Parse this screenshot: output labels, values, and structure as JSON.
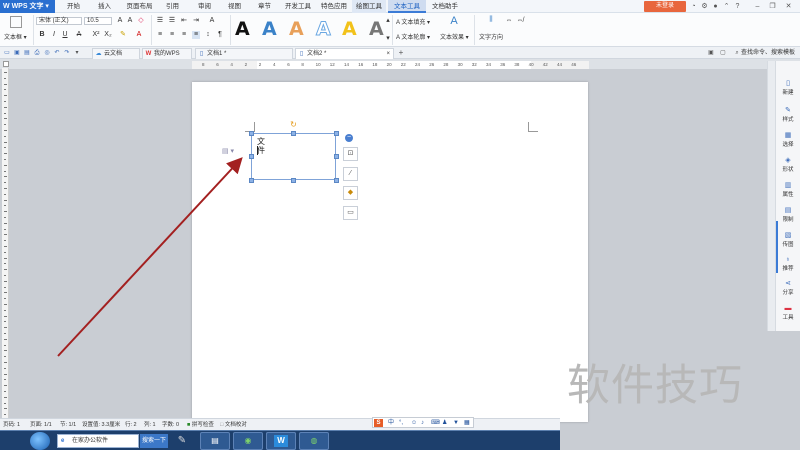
{
  "app": {
    "name": "WPS 文字"
  },
  "menu": {
    "items": [
      "开始",
      "插入",
      "页面布局",
      "引用",
      "审阅",
      "视图",
      "章节",
      "开发工具",
      "特色应用",
      "绘图工具",
      "文本工具",
      "文档助手"
    ],
    "login_label": "未登录"
  },
  "ribbon": {
    "textbox_label": "文本框",
    "font_name": "宋体 (正文)",
    "font_size": "10.5",
    "text_fill": "文本填充",
    "text_outline": "文本轮廓",
    "text_effect": "文本效果",
    "text_direction": "文字方向",
    "art_letter": "A"
  },
  "tabs": {
    "items": [
      {
        "label": "云文档"
      },
      {
        "label": "我的WPS"
      },
      {
        "label": "文档1 *"
      },
      {
        "label": "文档2 *"
      }
    ],
    "new_tab": "+",
    "search_placeholder": "查找命令、搜索模板"
  },
  "ruler": {
    "numbers": [
      "8",
      "6",
      "4",
      "2",
      "2",
      "4",
      "6",
      "8",
      "10",
      "12",
      "14",
      "16",
      "18",
      "20",
      "22",
      "24",
      "26",
      "28",
      "30",
      "32",
      "34",
      "36",
      "38",
      "40",
      "42",
      "44",
      "46"
    ]
  },
  "textbox": {
    "text": "文件"
  },
  "sidebar": {
    "items": [
      {
        "label": "新建",
        "icon": "new-doc-icon"
      },
      {
        "label": "样式",
        "icon": "style-icon"
      },
      {
        "label": "选择",
        "icon": "select-icon"
      },
      {
        "label": "形状",
        "icon": "shape-icon"
      },
      {
        "label": "属性",
        "icon": "properties-icon"
      },
      {
        "label": "限制",
        "icon": "restrict-icon"
      },
      {
        "label": "传图",
        "icon": "upload-image-icon"
      },
      {
        "label": "推荐",
        "icon": "recommend-icon"
      },
      {
        "label": "分享",
        "icon": "share-icon"
      },
      {
        "label": "工具",
        "icon": "toolbox-icon"
      }
    ]
  },
  "status": {
    "page_num": "页码: 1",
    "pages": "页面: 1/1",
    "section": "节: 1/1",
    "setting": "设置值: 3.3厘米",
    "row": "行: 2",
    "col": "列: 1",
    "words": "字数: 0",
    "spell": "拼写检查",
    "proof": "文档校对"
  },
  "ime": {
    "logo": "S",
    "mode": "中"
  },
  "taskbar": {
    "search_value": "在家办公软件",
    "search_button": "搜索一下",
    "wps_letter": "W"
  },
  "watermark": "软件技巧",
  "colors": {
    "accent": "#2a6fd0",
    "login": "#e8663d",
    "arrow": "#a32020",
    "rotate": "#e49a19"
  }
}
